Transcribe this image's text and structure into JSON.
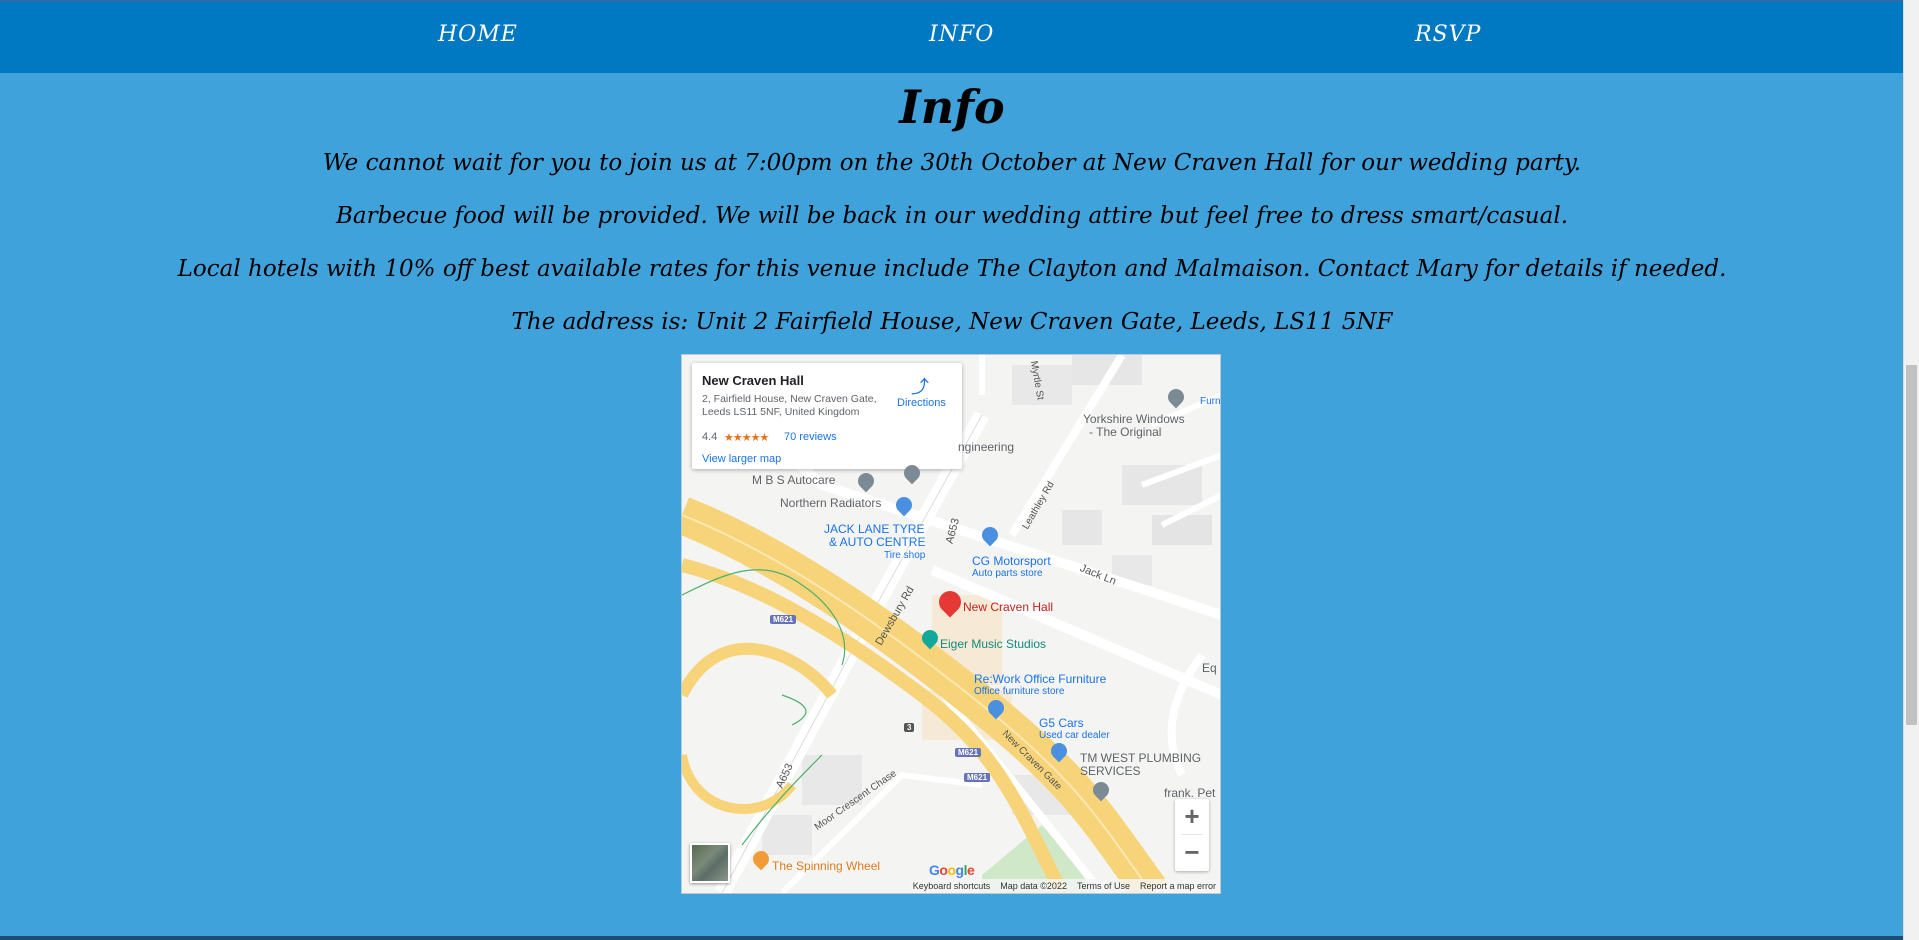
{
  "nav": {
    "home": "HOME",
    "info": "INFO",
    "rsvp": "RSVP"
  },
  "page": {
    "title": "Info",
    "paragraphs": [
      "We cannot wait for you to join us at 7:00pm on the 30th October at New Craven Hall for our wedding party.",
      "Barbecue food will be provided. We will be back in our wedding attire but feel free to dress smart/casual.",
      "Local hotels with 10% off best available rates for this venue include The Clayton and Malmaison. Contact Mary for details if needed.",
      "The address is: Unit 2 Fairfield House, New Craven Gate, Leeds, LS11 5NF"
    ]
  },
  "map": {
    "card": {
      "name": "New Craven Hall",
      "address": "2, Fairfield House, New Craven Gate, Leeds LS11 5NF, United Kingdom",
      "rating": "4.4",
      "stars": "★★★★★",
      "reviews": "70 reviews",
      "larger_map": "View larger map",
      "directions": "Directions"
    },
    "labels": {
      "engineering": "ngineering",
      "mbs": "M B S Autocare",
      "northern": "Northern Radiators",
      "jack_lane_1": "JACK LANE TYRE",
      "jack_lane_2": "& AUTO CENTRE",
      "tire_shop": "Tire shop",
      "cg": "CG Motorsport",
      "cg_sub": "Auto parts store",
      "yorkshire_1": "Yorkshire Windows",
      "yorkshire_2": "- The Original",
      "furn": "Furn",
      "new_craven": "New Craven Hall",
      "eiger": "Eiger Music Studios",
      "rework": "Re:Work Office Furniture",
      "rework_sub": "Office furniture store",
      "g5": "G5 Cars",
      "g5_sub": "Used car dealer",
      "tm_1": "TM WEST PLUMBING",
      "tm_2": "SERVICES",
      "frank": "frank. Pet",
      "eq": "Eq",
      "spinning": "The Spinning Wheel",
      "road_a653_1": "A653",
      "road_a653_2": "A653",
      "road_dewsbury": "Dewsbury Rd",
      "road_jack_ln": "Jack Ln",
      "road_leathley": "Leathley Rd",
      "road_myrtle": "Myrtle St",
      "road_ncg": "New Craven Gate",
      "road_moor": "Moor Crescent Chase",
      "m621_a": "M621",
      "m621_b": "M621",
      "m621_c": "M621",
      "exit_3": "3"
    },
    "zoom_in": "+",
    "zoom_out": "−",
    "google": "Google",
    "attribution": {
      "keyboard": "Keyboard shortcuts",
      "mapdata": "Map data ©2022",
      "terms": "Terms of Use",
      "report": "Report a map error"
    }
  }
}
